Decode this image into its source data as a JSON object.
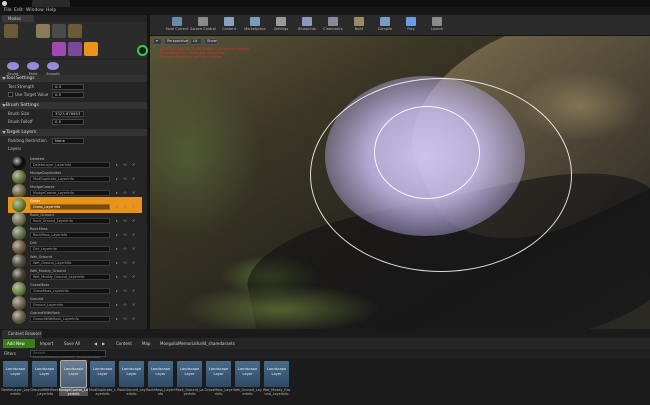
{
  "menu": [
    "File",
    "Edit",
    "Window",
    "Help"
  ],
  "panel": {
    "tab": "Modes",
    "tools": [
      "Sculpt",
      "Paint",
      "Smooth"
    ],
    "tool_settings": {
      "header": "Tool Settings",
      "tool_strength_label": "Tool Strength",
      "tool_strength": "0.3",
      "use_target_label": "Use Target Value",
      "use_target": "0.5"
    },
    "brush_settings": {
      "header": "Brush Settings",
      "brush_size_label": "Brush Size",
      "brush_size": "3323.876953",
      "brush_falloff_label": "Brush Falloff",
      "brush_falloff": "0.5"
    },
    "target_layers": {
      "header": "Target Layers",
      "painting_restriction_label": "Painting Restriction",
      "painting_restriction": "None",
      "layers_label": "Layers"
    },
    "layers": [
      {
        "name": "Deleted",
        "file": "DeleteLayer_LayerInfo",
        "color": "#0a0a0a"
      },
      {
        "name": "MudgeDuplicates",
        "file": "MudDuplicate_LayerInfo",
        "color": "#6a7a3a"
      },
      {
        "name": "MudgeCoarse",
        "file": "MudgeCoarse_LayerInfo",
        "color": "#7a6a44"
      },
      {
        "name": "Grass",
        "file": "Grass_LayerInfo",
        "color": "#6a8a30",
        "selected": true
      },
      {
        "name": "Rock_Ground",
        "file": "Rock_Ground_LayerInfo",
        "color": "#7a7a5a"
      },
      {
        "name": "RockMoss",
        "file": "RockMoss_LayerInfo",
        "color": "#6a7a4a"
      },
      {
        "name": "Dirt",
        "file": "Dirt_LayerInfo",
        "color": "#7a6240"
      },
      {
        "name": "Wet_Ground",
        "file": "Wet_Ground_LayerInfo",
        "color": "#5a5242"
      },
      {
        "name": "Wet_Muddy_Ground",
        "file": "Wet_Muddy_Ground_LayerInfo",
        "color": "#4a4232"
      },
      {
        "name": "GrassMoss",
        "file": "GrassMoss_LayerInfo",
        "color": "#748a42"
      },
      {
        "name": "Ground",
        "file": "Ground_LayerInfo",
        "color": "#7a6a50"
      },
      {
        "name": "GroundWithRock",
        "file": "GroundWithRock_LayerInfo",
        "color": "#6a624a"
      }
    ]
  },
  "toolbar": [
    {
      "label": "Save Current",
      "color": "#6a8aaa"
    },
    {
      "label": "Source Control",
      "color": "#8a8a8a"
    },
    {
      "label": "Content",
      "color": "#8aa0c0"
    },
    {
      "label": "Marketplace",
      "color": "#7a9abf"
    },
    {
      "label": "Settings",
      "color": "#9a9a9a"
    },
    {
      "label": "Blueprints",
      "color": "#8a9aba"
    },
    {
      "label": "Cinematics",
      "color": "#8a8a9a"
    },
    {
      "label": "Build",
      "color": "#9a8a6a"
    },
    {
      "label": "Compile",
      "color": "#7a9aca"
    },
    {
      "label": "Play",
      "color": "#6a9adf"
    },
    {
      "label": "Launch",
      "color": "#8a8a8a"
    }
  ],
  "viewport": {
    "view_mode": "Perspective",
    "lit": "Lit",
    "show": "Show",
    "warning_lines": [
      "LIGHTING NEEDS TO BE REBUILT (8 unbuilt objects)",
      "Exceeded max Landscape GrassMap",
      "Texture streaming pool over budget"
    ]
  },
  "content_browser": {
    "tab": "Content Browser",
    "add_new": "Add New",
    "import": "Import",
    "save_all": "Save All",
    "path": [
      "Content",
      "Map",
      "MongoliaMemorialhall4_sharedassets"
    ],
    "filters": "Filters",
    "search_placeholder": "Search MongoliaMemorialhall4_sharedassets",
    "assets": [
      {
        "type": "Landscape Layer",
        "name": "DeleteLayer_LayerInfo"
      },
      {
        "type": "Landscape Layer",
        "name": "GroundWithRock_LayerInfo"
      },
      {
        "type": "Landscape Layer",
        "name": "MudgeCoarse_LayerInfo",
        "selected": true
      },
      {
        "type": "Landscape Layer",
        "name": "MudDuplicate_LayerInfo"
      },
      {
        "type": "Landscape Layer",
        "name": "RockGround_LayerInfo"
      },
      {
        "type": "Landscape Layer",
        "name": "RockMoss_LayerInfo"
      },
      {
        "type": "Landscape Layer",
        "name": "Rock_Ground_LayerInfo"
      },
      {
        "type": "Landscape Layer",
        "name": "GrassMoss_LayerInfo"
      },
      {
        "type": "Landscape Layer",
        "name": "Wet_Ground_LayerInfo"
      },
      {
        "type": "Landscape Layer",
        "name": "Wet_Muddy_Ground_LayerInfo"
      }
    ]
  },
  "colors": {
    "selected_layer": "#e8931a",
    "add_new": "#3c7a1e",
    "brush_falloff": "#d2c8f5",
    "warning": "#e03030"
  }
}
